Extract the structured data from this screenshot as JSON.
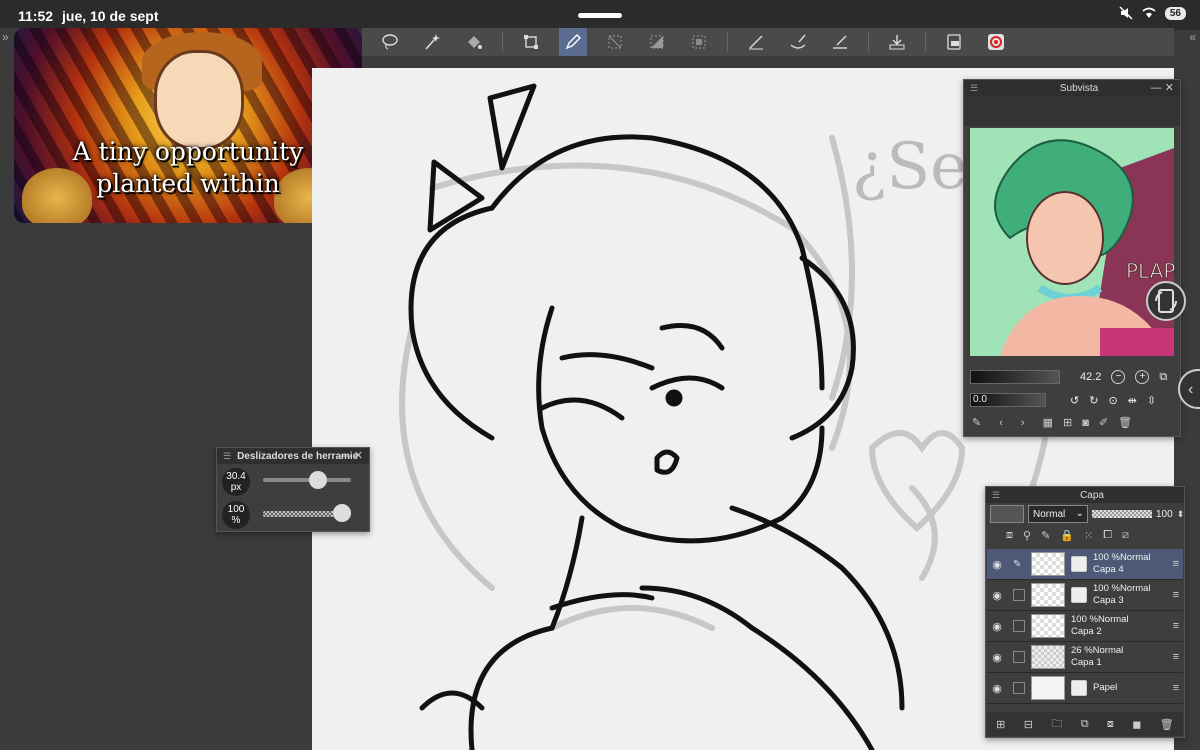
{
  "status": {
    "time": "11:52",
    "date": "jue, 10 de sept",
    "battery": "56",
    "icons": [
      "mute-icon",
      "wifi-icon",
      "battery-icon"
    ]
  },
  "banner": {
    "line1": "A tiny opportunity",
    "line2": "planted within"
  },
  "toolbar": {
    "tools": [
      "lasso-icon",
      "magic-wand-icon",
      "fill-icon",
      "transform-icon",
      "pen-icon",
      "clear-selection-icon",
      "invert-selection-icon",
      "select-all-icon",
      "line-tool-icon",
      "brush-size-icon",
      "ruler-icon",
      "save-icon",
      "export-icon",
      "swirl-icon"
    ],
    "active": "pen-icon"
  },
  "sliders_panel": {
    "title": "Deslizadores de herramie",
    "size_value": "30.4",
    "size_unit": "px",
    "opacity_value": "100",
    "opacity_unit": "%",
    "size_level": 0.62,
    "opacity_level": 1.0
  },
  "subvista": {
    "title": "Subvista",
    "zoom": "42.2",
    "rotation": "0.0",
    "preview_text": "PLAP"
  },
  "layers_panel": {
    "title": "Capa",
    "blend_mode": "Normal",
    "opacity": "100",
    "layers": [
      {
        "opacity": "100 %",
        "mode": "Normal",
        "name": "Capa 4",
        "selected": true,
        "type": "clear",
        "mask": true,
        "pen": true
      },
      {
        "opacity": "100 %",
        "mode": "Normal",
        "name": "Capa 3",
        "selected": false,
        "type": "clear",
        "mask": true,
        "pen": false
      },
      {
        "opacity": "100 %",
        "mode": "Normal",
        "name": "Capa 2",
        "selected": false,
        "type": "clear",
        "mask": false,
        "pen": false
      },
      {
        "opacity": "26 %",
        "mode": "Normal",
        "name": "Capa 1",
        "selected": false,
        "type": "sketch",
        "mask": false,
        "pen": false
      },
      {
        "opacity": "",
        "mode": "",
        "name": "Papel",
        "selected": false,
        "type": "paper",
        "mask": true,
        "pen": false
      }
    ]
  },
  "canvas": {
    "sketch_text": "¿Se"
  }
}
